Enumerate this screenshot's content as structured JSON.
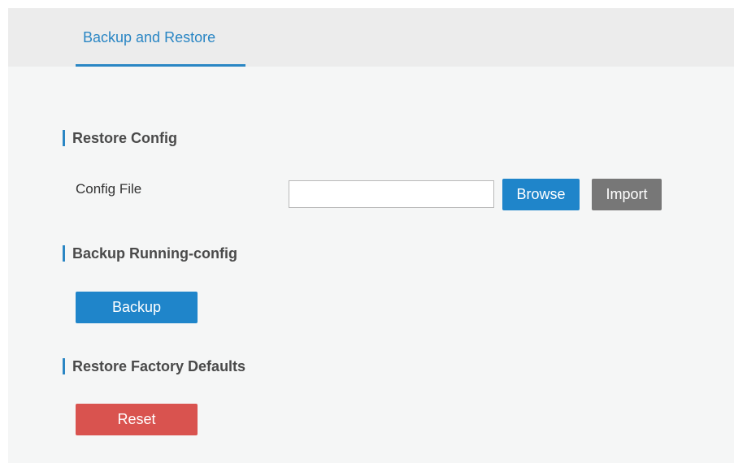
{
  "tabs": [
    {
      "label": "Backup and Restore",
      "active": true
    }
  ],
  "sections": {
    "restore_config": {
      "title": "Restore Config",
      "config_file_label": "Config File",
      "config_file_value": "",
      "browse_label": "Browse",
      "import_label": "Import"
    },
    "backup_running": {
      "title": "Backup Running-config",
      "backup_label": "Backup"
    },
    "factory_defaults": {
      "title": "Restore Factory Defaults",
      "reset_label": "Reset"
    }
  },
  "colors": {
    "accent": "#2a86c4",
    "primary_button": "#1f85ca",
    "neutral_button": "#777777",
    "danger_button": "#d9534f",
    "panel_background": "#f5f6f6",
    "tabbar_background": "#ececec"
  }
}
